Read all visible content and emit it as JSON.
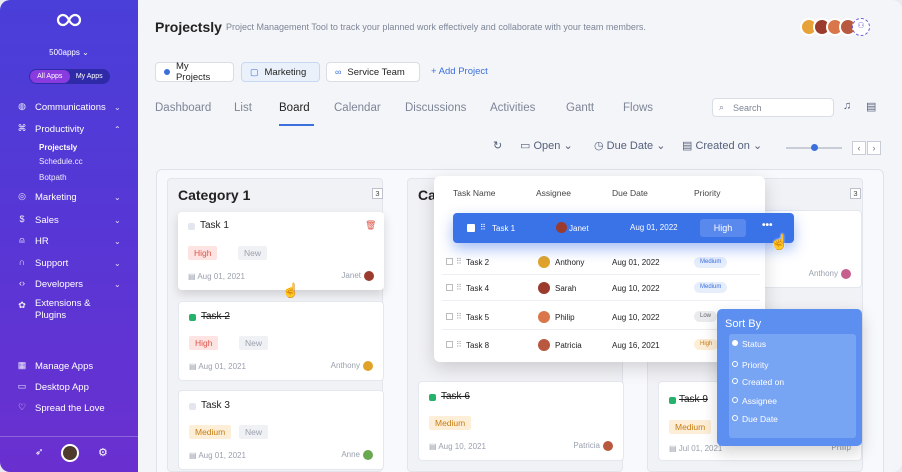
{
  "sidebar": {
    "org": "500apps",
    "toggle": [
      "All Apps",
      "My Apps"
    ],
    "nav": [
      {
        "label": "Communications",
        "icon": "globe-icon"
      },
      {
        "label": "Productivity",
        "icon": "command-icon"
      },
      {
        "label": "Marketing",
        "icon": "target-icon"
      },
      {
        "label": "Sales",
        "icon": "dollar-icon"
      },
      {
        "label": "HR",
        "icon": "person-icon"
      },
      {
        "label": "Support",
        "icon": "headset-icon"
      },
      {
        "label": "Developers",
        "icon": "code-icon"
      },
      {
        "label": "Extensions & Plugins",
        "icon": "puzzle-icon"
      }
    ],
    "subitems": [
      "Projectsly",
      "Schedule.cc",
      "Botpath"
    ],
    "bottom": [
      {
        "label": "Manage Apps",
        "icon": "grid-icon"
      },
      {
        "label": "Desktop App",
        "icon": "monitor-icon"
      },
      {
        "label": "Spread the Love",
        "icon": "heart-icon"
      }
    ]
  },
  "header": {
    "title": "Projectsly",
    "subtitle": "Project Management Tool to track your planned work effectively and collaborate with your team members."
  },
  "projects": [
    "My Projects",
    "Marketing",
    "Service Team"
  ],
  "add_project": "+ Add Project",
  "tabs": [
    "Dashboard",
    "List",
    "Board",
    "Calendar",
    "Discussions",
    "Activities",
    "Gantt",
    "Flows"
  ],
  "search_placeholder": "Search",
  "toolbar": {
    "open": "Open",
    "due_date": "Due Date",
    "created_on": "Created on"
  },
  "columns": [
    {
      "title": "Category 1",
      "count": "3"
    },
    {
      "title": "Ca",
      "count": ""
    },
    {
      "title": "",
      "count": "3"
    }
  ],
  "cards": [
    {
      "title": "Task 1",
      "priority": "High",
      "status": "New",
      "date": "Aug 01, 2021",
      "assignee": "Janet",
      "done": false
    },
    {
      "title": "Task 2",
      "priority": "High",
      "status": "New",
      "date": "Aug 01, 2021",
      "assignee": "Anthony",
      "done": true
    },
    {
      "title": "Task 3",
      "priority": "Medium",
      "status": "New",
      "date": "Aug 01, 2021",
      "assignee": "Anne",
      "done": false
    },
    {
      "title": "Task 6",
      "priority": "Medium",
      "status": "",
      "date": "Aug 10, 2021",
      "assignee": "Patricia",
      "done": true
    },
    {
      "title": "Task 9",
      "priority": "Medium",
      "status": "",
      "date": "Jul 01, 2021",
      "assignee": "Philip",
      "done": true
    },
    {
      "title": "",
      "priority": "",
      "status": "",
      "date": "",
      "assignee": "Anthony",
      "done": false
    }
  ],
  "table": {
    "headers": [
      "Task Name",
      "Assignee",
      "Due Date",
      "Priority"
    ],
    "dragging": {
      "task": "Task 1",
      "assignee": "Janet",
      "due": "Aug 01, 2022",
      "priority": "High"
    },
    "rows": [
      {
        "task": "Task 2",
        "assignee": "Anthony",
        "due": "Aug 01, 2022",
        "priority": "Medium"
      },
      {
        "task": "Task 4",
        "assignee": "Sarah",
        "due": "Aug 10, 2022",
        "priority": "Medium"
      },
      {
        "task": "Task 5",
        "assignee": "Philip",
        "due": "Aug 10, 2022",
        "priority": "Low"
      },
      {
        "task": "Task 8",
        "assignee": "Patricia",
        "due": "Aug 16, 2021",
        "priority": "High"
      }
    ]
  },
  "sort_by": {
    "title": "Sort By",
    "options": [
      "Status",
      "Priority",
      "Created on",
      "Assignee",
      "Due Date"
    ]
  },
  "colors": {
    "accent": "#3a72e8",
    "sidebar": "#5637d6",
    "high": "#de5448",
    "medium": "#c77d12",
    "done": "#26b26b"
  }
}
